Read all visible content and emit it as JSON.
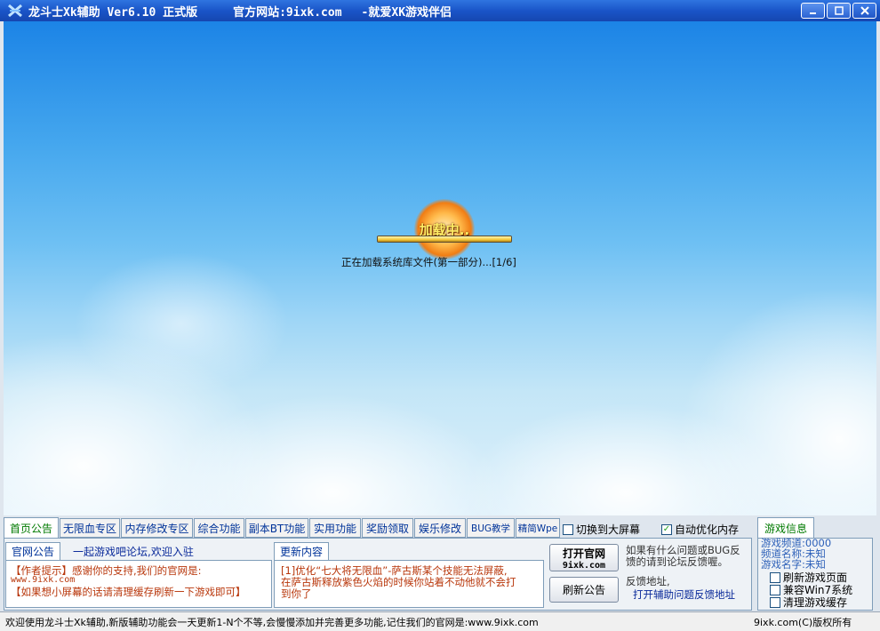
{
  "titlebar": {
    "app_title": "龙斗士Xk辅助 Ver6.10 正式版",
    "website": "官方网站:9ixk.com",
    "slogan": "-就爱XK游戏伴侣"
  },
  "game": {
    "loading_label": "加载中..",
    "loading_progress": 1.0,
    "status": "正在加载系统库文件(第一部分)...[1/6]"
  },
  "tabs": [
    {
      "label": "首页公告"
    },
    {
      "label": "无限血专区"
    },
    {
      "label": "内存修改专区"
    },
    {
      "label": "综合功能"
    },
    {
      "label": "副本BT功能"
    },
    {
      "label": "实用功能"
    },
    {
      "label": "奖励领取"
    },
    {
      "label": "娱乐修改"
    },
    {
      "label": "BUG教学"
    },
    {
      "label": "精简Wpe"
    }
  ],
  "options": {
    "fullscreen_label": "切换到大屏幕",
    "fullscreen_checked": false,
    "auto_optimize_label": "自动优化内存",
    "auto_optimize_checked": true
  },
  "announcement": {
    "tab_label": "官网公告",
    "forum_link": "一起游戏吧论坛,欢迎入驻",
    "line1": "【作者提示】感谢你的支持,我们的官网是:",
    "line2": "www.9ixk.com",
    "line3": "【如果想小屏幕的话请清理缓存刷新一下游戏即可】"
  },
  "updates": {
    "tab_label": "更新内容",
    "line1": "[1]优化“七大将无限血”-萨古斯某个技能无法屏蔽,",
    "line2": "在萨古斯释放紫色火焰的时候你站着不动他就不会打",
    "line3": "到你了"
  },
  "buttons": {
    "open_site_line1": "打开官网",
    "open_site_line2": "9ixk.com",
    "refresh_notice": "刷新公告"
  },
  "feedback": {
    "line1": "如果有什么问题或BUG反",
    "line2": "馈的请到论坛反馈喔。",
    "label": "反馈地址,",
    "link": "打开辅助问题反馈地址"
  },
  "game_info": {
    "tab_label": "游戏信息",
    "channel": "游戏频道:0000",
    "channel_name": "频道名称:未知",
    "game_name": "游戏名字:未知",
    "refresh_page_label": "刷新游戏页面",
    "win7_label": "兼容Win7系统",
    "clear_cache_label": "清理游戏缓存"
  },
  "statusbar": {
    "message": "欢迎使用龙斗士Xk辅助,新版辅助功能会一天更新1-N个不等,会慢慢添加并完善更多功能,记住我们的官网是:www.9ixk.com",
    "copyright": "9ixk.com(C)版权所有"
  }
}
